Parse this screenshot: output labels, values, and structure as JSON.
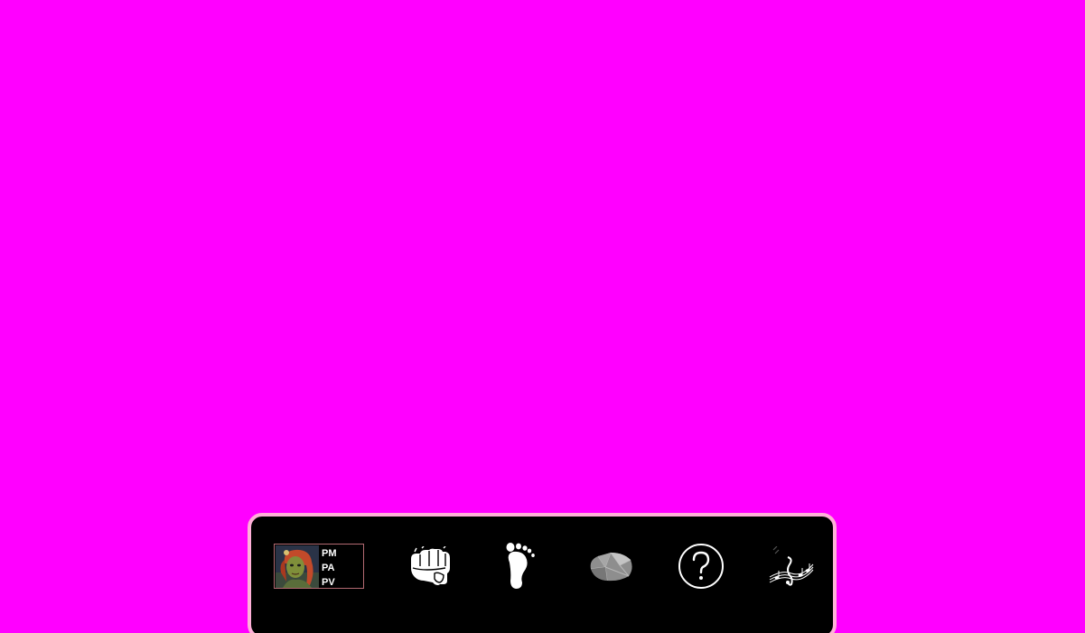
{
  "hud": {
    "character": {
      "stats": [
        "PM",
        "PA",
        "PV"
      ]
    },
    "actions": [
      {
        "id": "punch",
        "icon": "fist-icon"
      },
      {
        "id": "walk",
        "icon": "footprint-icon"
      },
      {
        "id": "rock",
        "icon": "rock-icon"
      },
      {
        "id": "help",
        "icon": "question-circle-icon"
      },
      {
        "id": "music",
        "icon": "music-notes-icon"
      }
    ]
  },
  "colors": {
    "background": "#ff00ff",
    "hud_background": "#000000",
    "hud_border": "#ffb0d8",
    "portrait_border": "#b36a72",
    "text": "#ffffff"
  }
}
